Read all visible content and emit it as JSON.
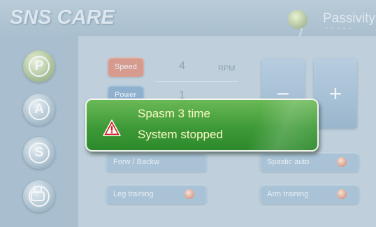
{
  "header": {
    "logo_text": "SNS CARE",
    "mode_label": "Passivity",
    "mode_icon": "p-figure-icon"
  },
  "sidebar": {
    "items": [
      {
        "label": "P",
        "icon": "p-circle-icon",
        "active": true
      },
      {
        "label": "A",
        "icon": "a-circle-icon"
      },
      {
        "label": "S",
        "icon": "s-circle-icon"
      },
      {
        "label": "",
        "icon": "tv-icon"
      }
    ]
  },
  "controls": {
    "speed": {
      "label": "Speed",
      "value": "4",
      "unit": "RPM"
    },
    "power": {
      "label": "Power",
      "value": "1"
    },
    "minus_label": "−",
    "plus_label": "+",
    "forw_backw_label": "Forw / Backw",
    "spastic_auto_label": "Spastic auto",
    "leg_training_label": "Leg training",
    "arm_training_label": "Arm training"
  },
  "alert": {
    "line1": "Spasm 3 time",
    "line2": "System stopped",
    "icon": "warning-triangle-icon",
    "colors": {
      "background": "#3e9a37",
      "text": "#fff8c8",
      "icon_red": "#cc1f1f"
    }
  }
}
